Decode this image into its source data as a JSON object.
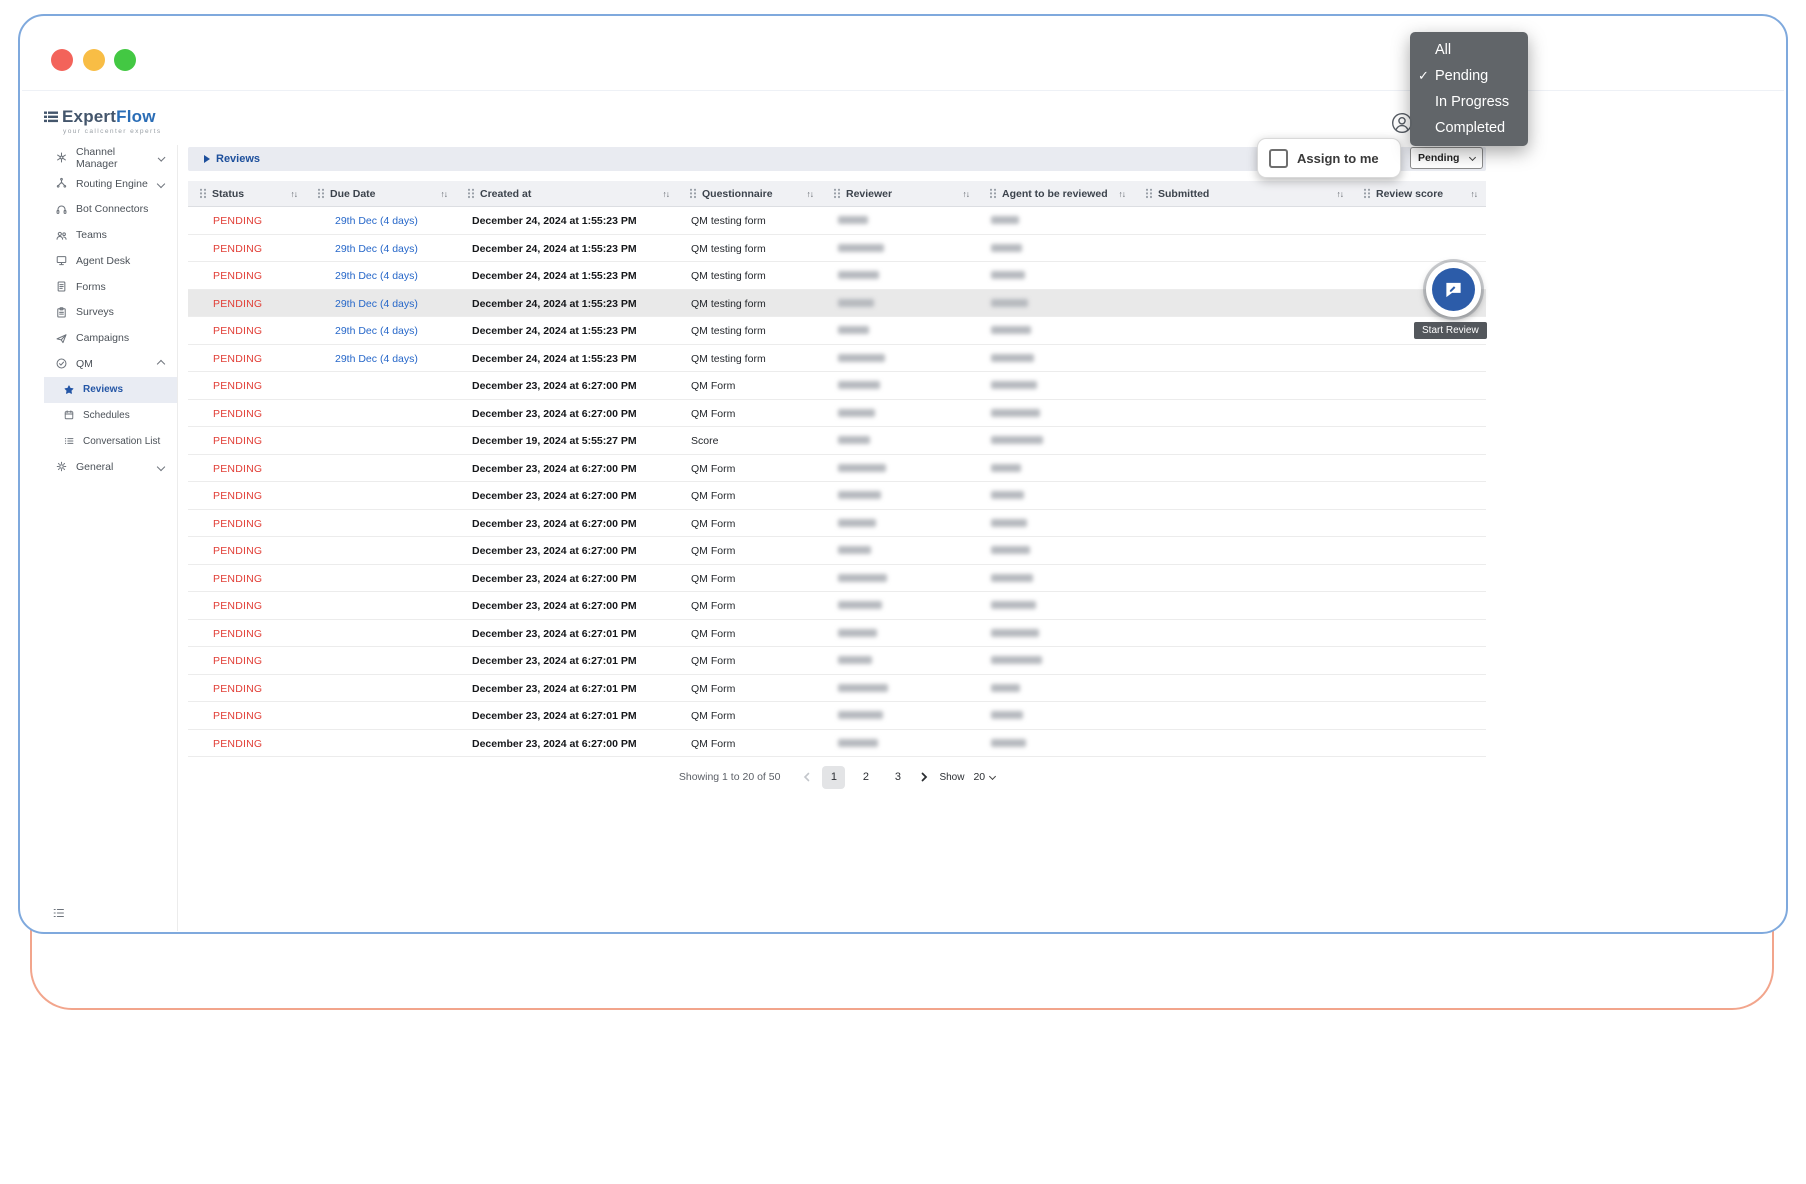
{
  "window": {
    "traffic_lights": [
      {
        "name": "close",
        "color": "#f3635a"
      },
      {
        "name": "minimize",
        "color": "#f8bd45"
      },
      {
        "name": "maximize",
        "color": "#43c843"
      }
    ]
  },
  "brand": {
    "name_primary": "Expert",
    "name_secondary": "Flow",
    "tagline": "your callcenter experts"
  },
  "status_menu": {
    "items": [
      {
        "label": "All",
        "checked": false
      },
      {
        "label": "Pending",
        "checked": true
      },
      {
        "label": "In Progress",
        "checked": false
      },
      {
        "label": "Completed",
        "checked": false
      }
    ],
    "checkmark": "✓"
  },
  "sidebar": {
    "items": [
      {
        "label": "Channel Manager"
      },
      {
        "label": "Routing Engine"
      },
      {
        "label": "Bot Connectors"
      },
      {
        "label": "Teams"
      },
      {
        "label": "Agent Desk"
      },
      {
        "label": "Forms"
      },
      {
        "label": "Surveys"
      },
      {
        "label": "Campaigns"
      },
      {
        "label": "QM"
      },
      {
        "label": "Reviews",
        "selected": true
      },
      {
        "label": "Schedules"
      },
      {
        "label": "Conversation List"
      },
      {
        "label": "General"
      }
    ]
  },
  "toolbar": {
    "breadcrumb": "Reviews",
    "assign_label": "Assign to me",
    "assign_checked": false,
    "status_filter_value": "Pending"
  },
  "table": {
    "columns": [
      "Status",
      "Due Date",
      "Created at",
      "Questionnaire",
      "Reviewer",
      "Agent to be reviewed",
      "Submitted",
      "Review score"
    ],
    "redacted_columns": [
      "Reviewer",
      "Agent to be reviewed"
    ],
    "rows": [
      {
        "status": "PENDING",
        "due_date": "29th Dec (4 days)",
        "created_at": "December 24, 2024 at 1:55:23 PM",
        "questionnaire": "QM testing form"
      },
      {
        "status": "PENDING",
        "due_date": "29th Dec (4 days)",
        "created_at": "December 24, 2024 at 1:55:23 PM",
        "questionnaire": "QM testing form"
      },
      {
        "status": "PENDING",
        "due_date": "29th Dec (4 days)",
        "created_at": "December 24, 2024 at 1:55:23 PM",
        "questionnaire": "QM testing form"
      },
      {
        "status": "PENDING",
        "due_date": "29th Dec (4 days)",
        "created_at": "December 24, 2024 at 1:55:23 PM",
        "questionnaire": "QM testing form",
        "highlighted": true
      },
      {
        "status": "PENDING",
        "due_date": "29th Dec (4 days)",
        "created_at": "December 24, 2024 at 1:55:23 PM",
        "questionnaire": "QM testing form"
      },
      {
        "status": "PENDING",
        "due_date": "29th Dec (4 days)",
        "created_at": "December 24, 2024 at 1:55:23 PM",
        "questionnaire": "QM testing form"
      },
      {
        "status": "PENDING",
        "due_date": "",
        "created_at": "December 23, 2024 at 6:27:00 PM",
        "questionnaire": "QM Form"
      },
      {
        "status": "PENDING",
        "due_date": "",
        "created_at": "December 23, 2024 at 6:27:00 PM",
        "questionnaire": "QM Form"
      },
      {
        "status": "PENDING",
        "due_date": "",
        "created_at": "December 19, 2024 at 5:55:27 PM",
        "questionnaire": "Score"
      },
      {
        "status": "PENDING",
        "due_date": "",
        "created_at": "December 23, 2024 at 6:27:00 PM",
        "questionnaire": "QM Form"
      },
      {
        "status": "PENDING",
        "due_date": "",
        "created_at": "December 23, 2024 at 6:27:00 PM",
        "questionnaire": "QM Form"
      },
      {
        "status": "PENDING",
        "due_date": "",
        "created_at": "December 23, 2024 at 6:27:00 PM",
        "questionnaire": "QM Form"
      },
      {
        "status": "PENDING",
        "due_date": "",
        "created_at": "December 23, 2024 at 6:27:00 PM",
        "questionnaire": "QM Form"
      },
      {
        "status": "PENDING",
        "due_date": "",
        "created_at": "December 23, 2024 at 6:27:00 PM",
        "questionnaire": "QM Form"
      },
      {
        "status": "PENDING",
        "due_date": "",
        "created_at": "December 23, 2024 at 6:27:00 PM",
        "questionnaire": "QM Form"
      },
      {
        "status": "PENDING",
        "due_date": "",
        "created_at": "December 23, 2024 at 6:27:01 PM",
        "questionnaire": "QM Form"
      },
      {
        "status": "PENDING",
        "due_date": "",
        "created_at": "December 23, 2024 at 6:27:01 PM",
        "questionnaire": "QM Form"
      },
      {
        "status": "PENDING",
        "due_date": "",
        "created_at": "December 23, 2024 at 6:27:01 PM",
        "questionnaire": "QM Form"
      },
      {
        "status": "PENDING",
        "due_date": "",
        "created_at": "December 23, 2024 at 6:27:01 PM",
        "questionnaire": "QM Form"
      },
      {
        "status": "PENDING",
        "due_date": "",
        "created_at": "December 23, 2024 at 6:27:00 PM",
        "questionnaire": "QM Form"
      }
    ]
  },
  "fab": {
    "tooltip": "Start Review"
  },
  "pagination": {
    "summary": "Showing 1 to 20 of 50",
    "pages": [
      "1",
      "2",
      "3"
    ],
    "active_page": "1",
    "show_label": "Show",
    "page_size": "20"
  }
}
